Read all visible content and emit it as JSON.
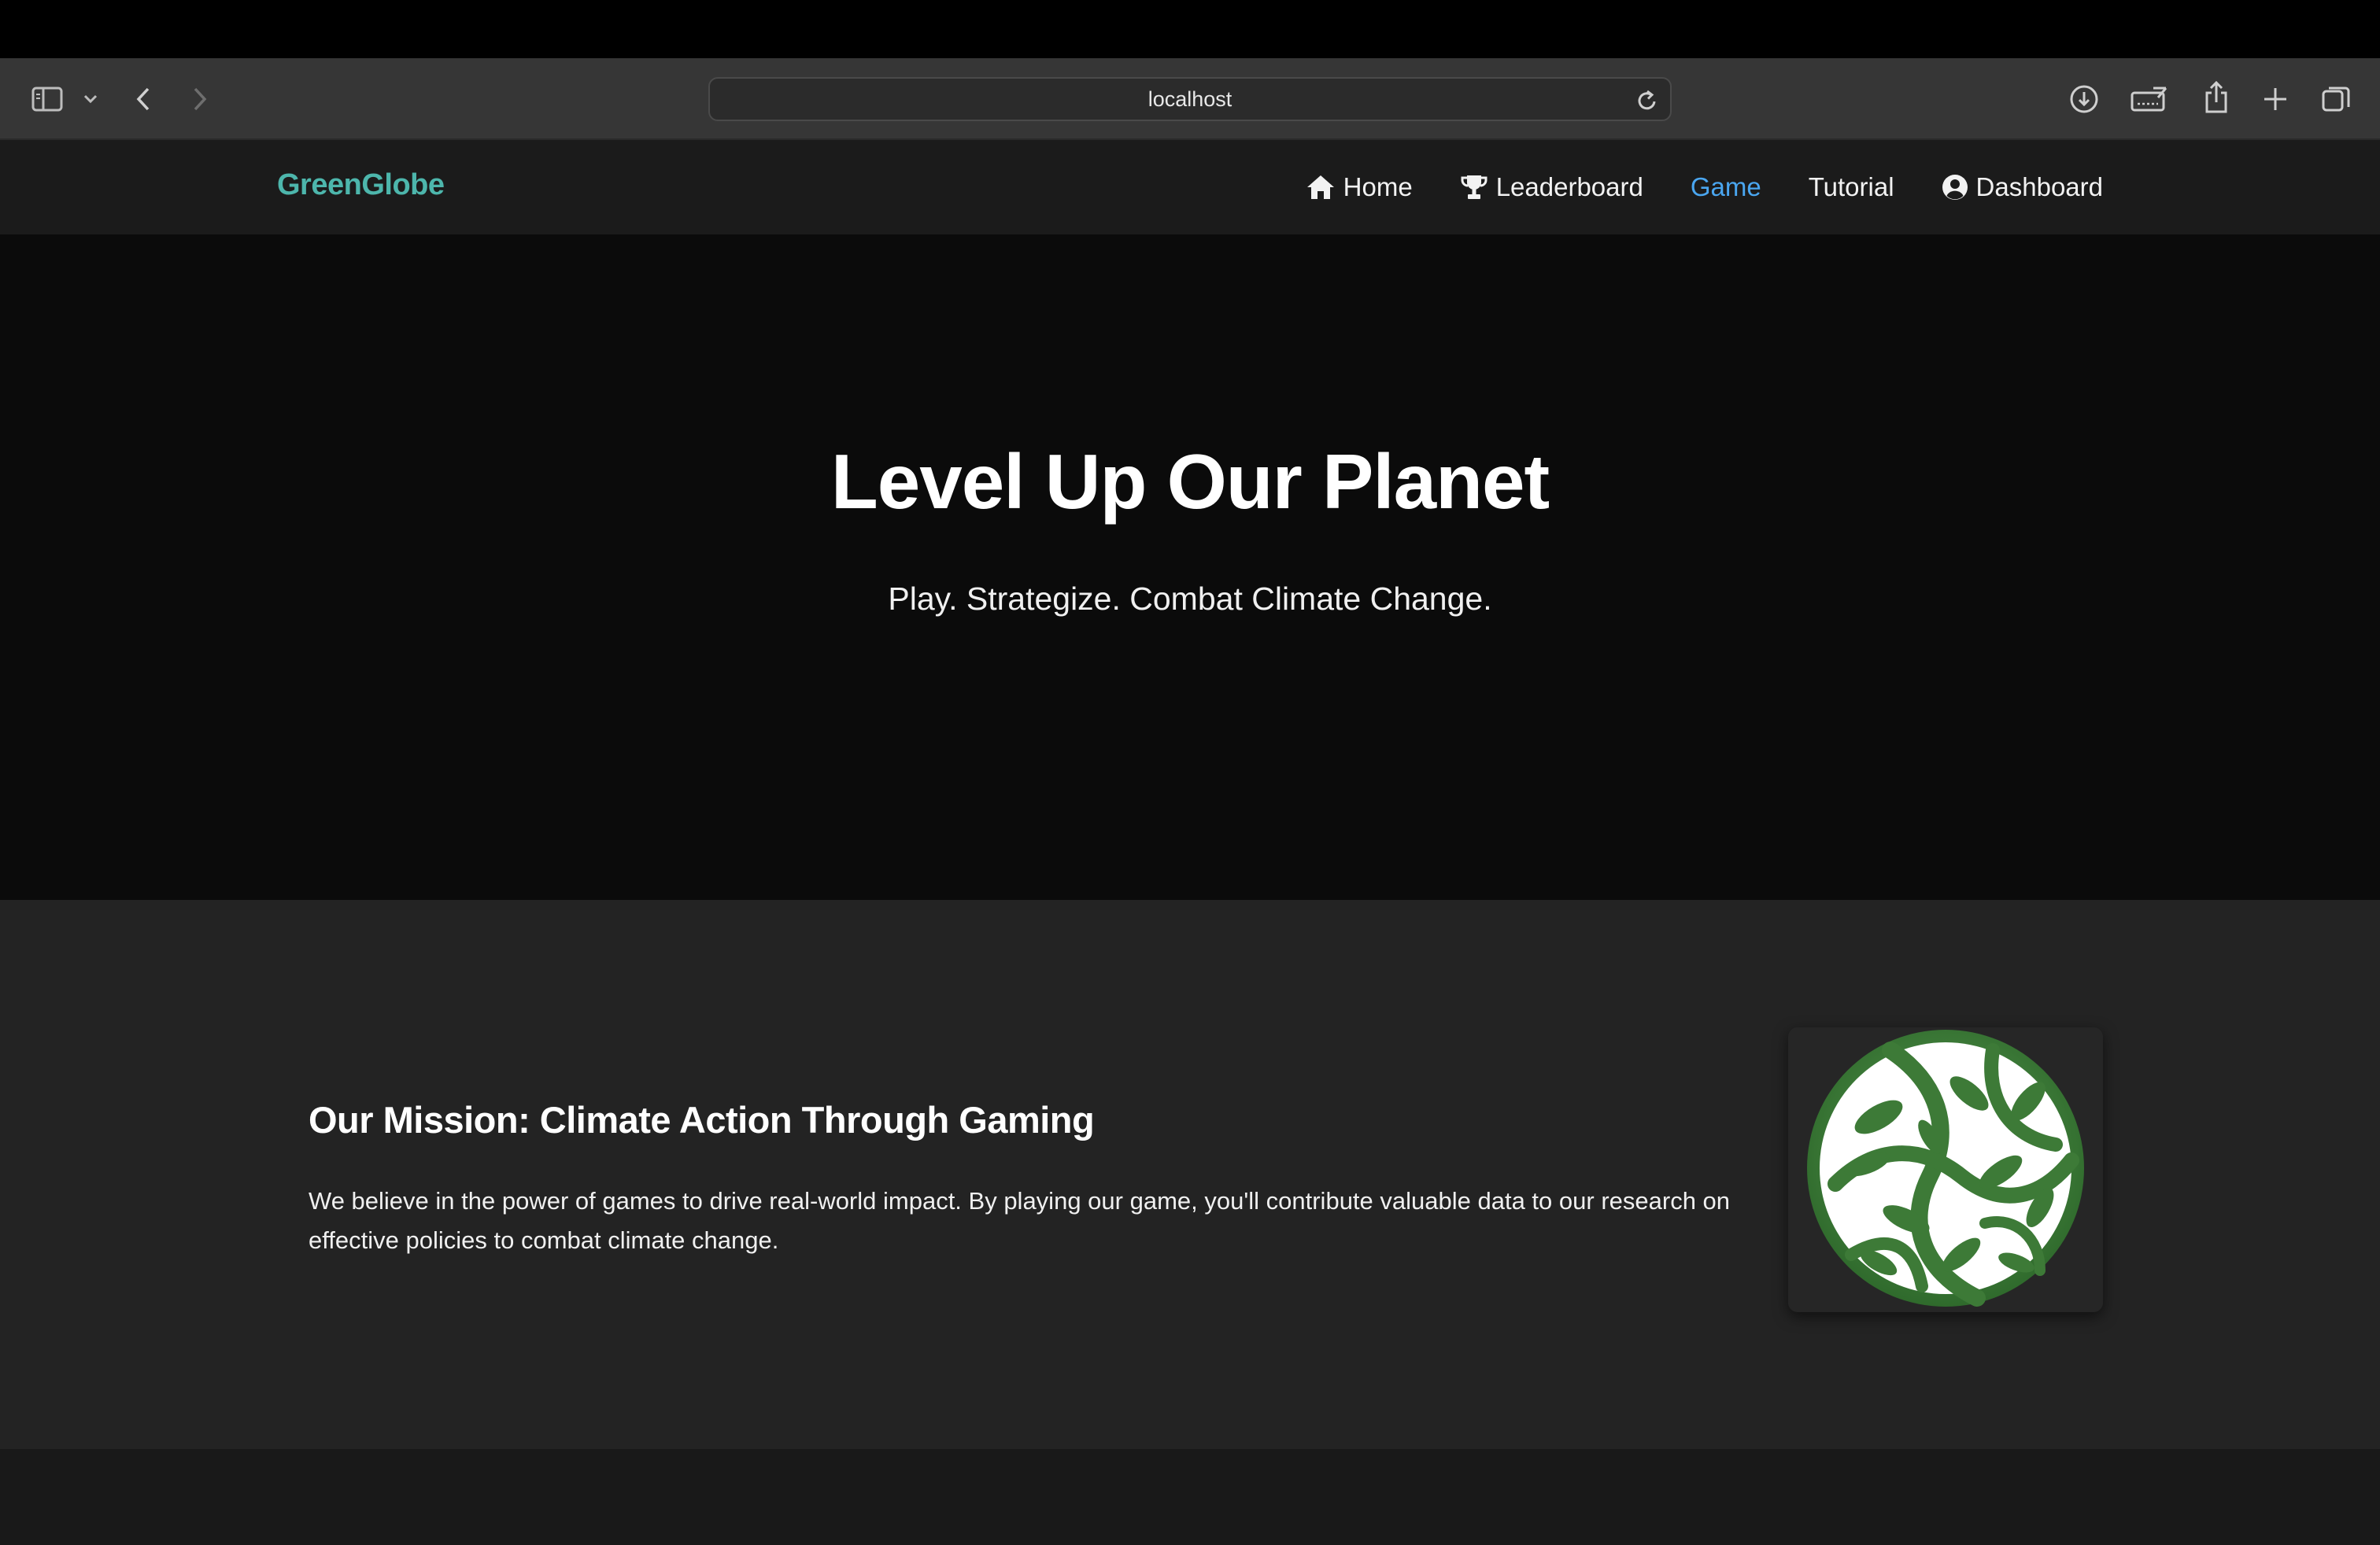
{
  "browser": {
    "address": "localhost"
  },
  "nav": {
    "brand": "GreenGlobe",
    "links": [
      {
        "label": "Home",
        "icon": "home-icon"
      },
      {
        "label": "Leaderboard",
        "icon": "trophy-icon"
      },
      {
        "label": "Game",
        "active": true
      },
      {
        "label": "Tutorial"
      },
      {
        "label": "Dashboard",
        "icon": "user-circle-icon"
      }
    ]
  },
  "hero": {
    "title": "Level Up Our Planet",
    "subtitle": "Play. Strategize. Combat Climate Change."
  },
  "mission": {
    "title": "Our Mission: Climate Action Through Gaming",
    "text": "We believe in the power of games to drive real-world impact. By playing our game, you'll contribute valuable data to our research on effective policies to combat climate change.",
    "logo_icon": "leaf-globe-logo"
  },
  "colors": {
    "brand": "#4db6ac",
    "active_link": "#4aa6f0",
    "logo_green": "#3f7d3a"
  }
}
